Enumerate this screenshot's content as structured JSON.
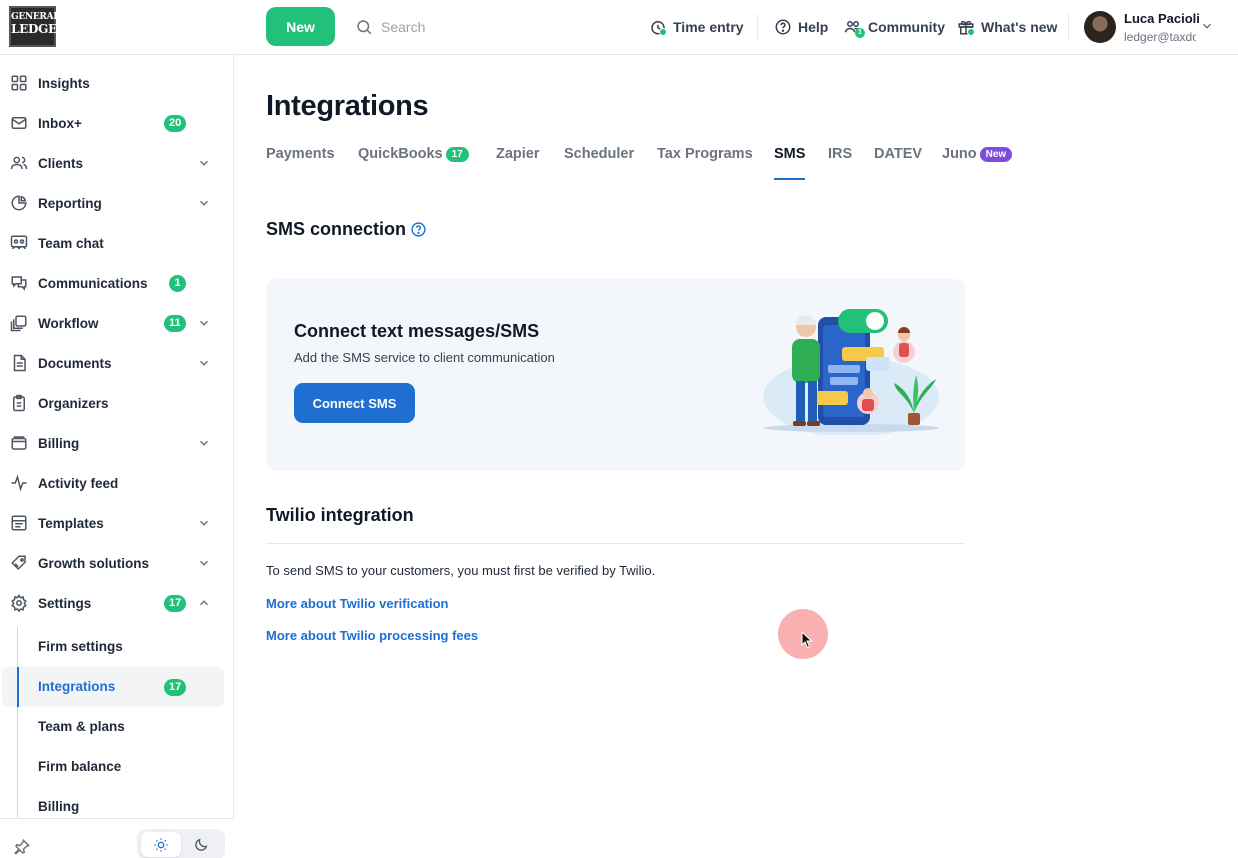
{
  "header": {
    "logo": {
      "line1": "GENERAL",
      "line2": "LEDGER"
    },
    "new_label": "New",
    "search_placeholder": "Search",
    "time_entry": "Time entry",
    "help": "Help",
    "community": "Community",
    "community_count": "1",
    "whats_new": "What's new",
    "user": {
      "name": "Luca Pacioli",
      "email": "ledger@taxdome.com"
    }
  },
  "sidebar": {
    "items": [
      {
        "label": "Insights",
        "icon": "grid-icon"
      },
      {
        "label": "Inbox+",
        "icon": "mail-icon",
        "badge": "20"
      },
      {
        "label": "Clients",
        "icon": "users-icon"
      },
      {
        "label": "Reporting",
        "icon": "pie-chart-icon"
      },
      {
        "label": "Team chat",
        "icon": "team-chat-icon"
      },
      {
        "label": "Communications",
        "icon": "chat-bubbles-icon",
        "badge": "1"
      },
      {
        "label": "Workflow",
        "icon": "layers-icon",
        "badge": "11"
      },
      {
        "label": "Documents",
        "icon": "document-icon"
      },
      {
        "label": "Organizers",
        "icon": "clipboard-icon"
      },
      {
        "label": "Billing",
        "icon": "wallet-icon"
      },
      {
        "label": "Activity feed",
        "icon": "activity-icon"
      },
      {
        "label": "Templates",
        "icon": "template-icon"
      },
      {
        "label": "Growth solutions",
        "icon": "rocket-tag-icon"
      },
      {
        "label": "Settings",
        "icon": "gear-icon",
        "badge": "17"
      }
    ],
    "settings_sub": [
      {
        "label": "Firm settings"
      },
      {
        "label": "Integrations",
        "badge": "17"
      },
      {
        "label": "Team & plans"
      },
      {
        "label": "Firm balance"
      },
      {
        "label": "Billing"
      }
    ]
  },
  "main": {
    "title": "Integrations",
    "tabs": [
      {
        "label": "Payments"
      },
      {
        "label": "QuickBooks",
        "badge": "17"
      },
      {
        "label": "Zapier"
      },
      {
        "label": "Scheduler"
      },
      {
        "label": "Tax Programs"
      },
      {
        "label": "SMS"
      },
      {
        "label": "IRS"
      },
      {
        "label": "DATEV"
      },
      {
        "label": "Juno",
        "badge": "New"
      }
    ],
    "active_tab": "SMS",
    "sms_connection_title": "SMS connection",
    "card": {
      "title": "Connect text messages/SMS",
      "subtitle": "Add the SMS service to client communication",
      "button": "Connect SMS"
    },
    "twilio_title": "Twilio integration",
    "twilio_text": "To send SMS to your customers, you must first be verified by Twilio.",
    "link_verification": "More about Twilio verification",
    "link_fees": "More about Twilio processing fees"
  },
  "colors": {
    "accent": "#1f6fd1",
    "success": "#22c17a",
    "new_badge": "#7c4ddb"
  }
}
